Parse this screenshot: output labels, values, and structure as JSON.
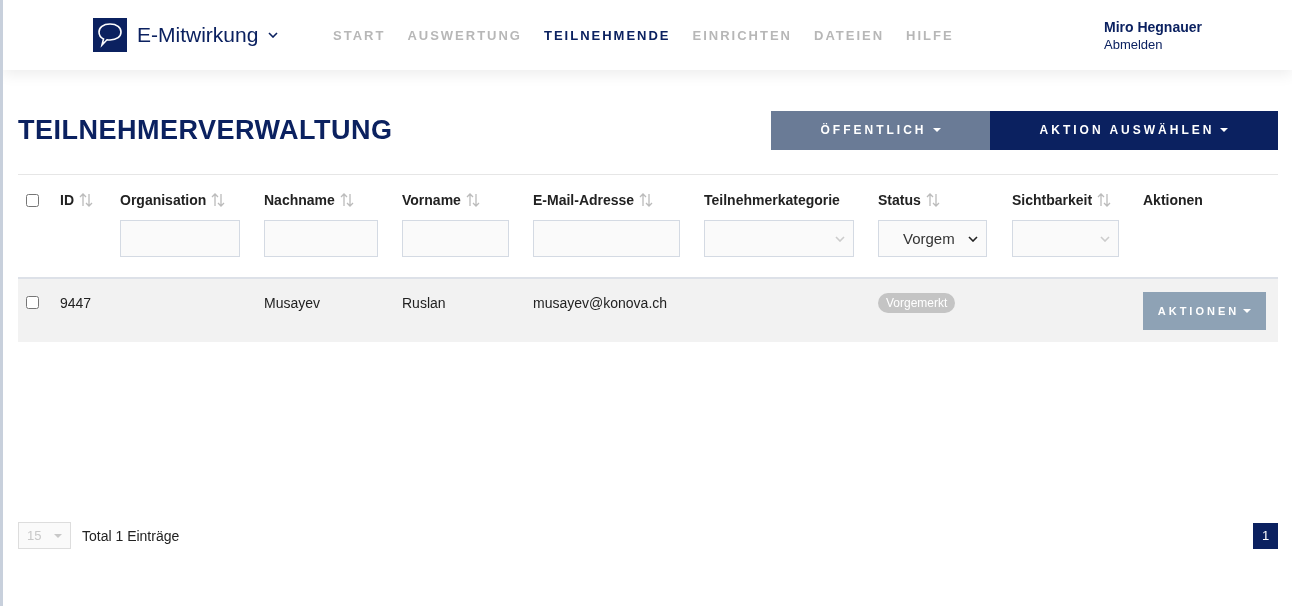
{
  "header": {
    "app_name": "E-Mitwirkung",
    "nav": [
      {
        "label": "START",
        "selected": false
      },
      {
        "label": "AUSWERTUNG",
        "selected": false
      },
      {
        "label": "TEILNEHMENDE",
        "selected": true
      },
      {
        "label": "EINRICHTEN",
        "selected": false
      },
      {
        "label": "DATEIEN",
        "selected": false
      },
      {
        "label": "HILFE",
        "selected": false
      }
    ],
    "user": {
      "name": "Miro Hegnauer",
      "logout": "Abmelden"
    }
  },
  "page_title": "TEILNEHMERVERWALTUNG",
  "toolbar": [
    {
      "label": "ÖFFENTLICH",
      "kind": "secondary"
    },
    {
      "label": "AKTION AUSWÄHLEN",
      "kind": "primary"
    }
  ],
  "table": {
    "select_all_checked": false,
    "columns": [
      {
        "label": "ID",
        "sortable": true,
        "kind": "plain"
      },
      {
        "label": "Organisation",
        "sortable": true,
        "kind": "text"
      },
      {
        "label": "Nachname",
        "sortable": true,
        "kind": "text"
      },
      {
        "label": "Vorname",
        "sortable": true,
        "kind": "text"
      },
      {
        "label": "E-Mail-Adresse",
        "sortable": true,
        "kind": "text"
      },
      {
        "label": "Teilnehmerkategorie",
        "sortable": false,
        "kind": "select",
        "disabled": true
      },
      {
        "label": "Status",
        "sortable": true,
        "kind": "select",
        "disabled": false,
        "value": "Vorgem"
      },
      {
        "label": "Sichtbarkeit",
        "sortable": true,
        "kind": "select",
        "disabled": true
      },
      {
        "label": "Aktionen",
        "sortable": false,
        "kind": "plain"
      }
    ],
    "rows": [
      {
        "checked": false,
        "id": "9447",
        "nachname": "Musayev",
        "vorname": "Ruslan",
        "email": "musayev@konova.ch",
        "status": "Vorgemerkt",
        "action": "AKTIONEN"
      }
    ]
  },
  "footer": {
    "page_size": "15",
    "page_size_disabled": true,
    "total": "Total 1 Einträge",
    "pages": [
      {
        "label": "1",
        "selected": true
      }
    ]
  }
}
